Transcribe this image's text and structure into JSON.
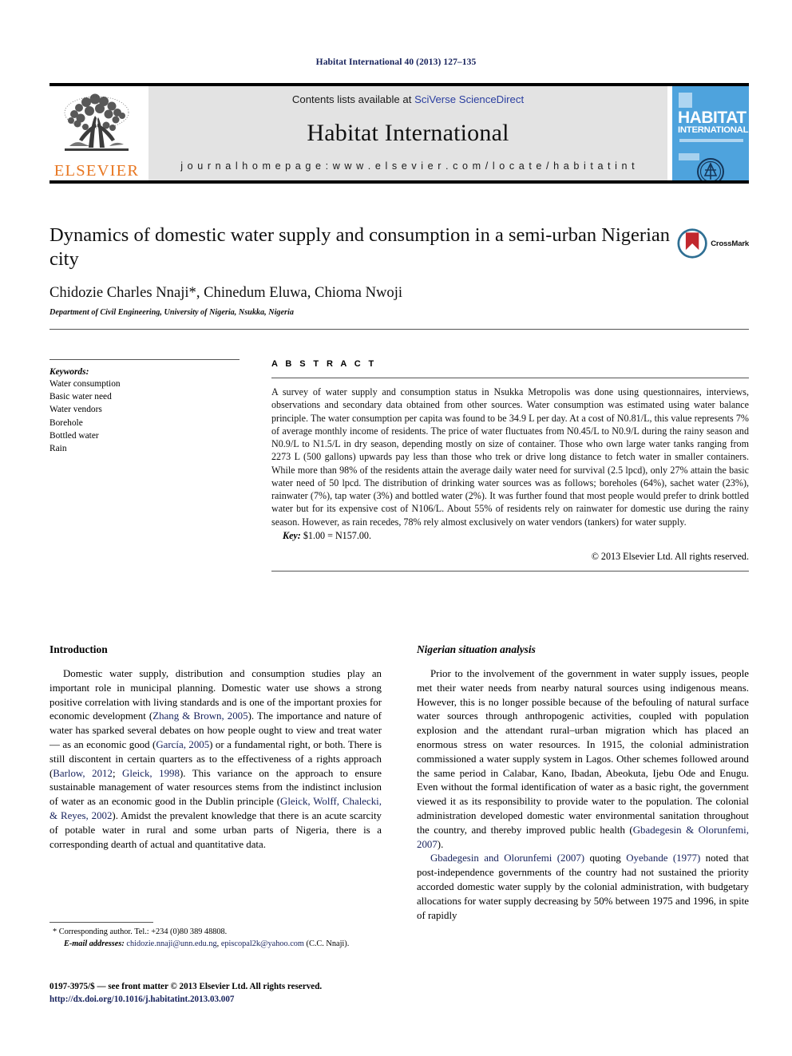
{
  "running_head": "Habitat International 40 (2013) 127–135",
  "masthead": {
    "publisher_logo_name": "ELSEVIER",
    "contents_prefix": "Contents lists available at ",
    "contents_link": "SciVerse ScienceDirect",
    "journal_name": "Habitat International",
    "homepage_label": "j o u r n a l   h o m e p a g e :   w w w . e l s e v i e r . c o m / l o c a t e / h a b i t a t i n t",
    "cover": {
      "line1": "HABITAT",
      "line2": "INTERNATIONAL"
    }
  },
  "article": {
    "title": "Dynamics of domestic water supply and consumption in a semi-urban Nigerian city",
    "crossmark_label": "CrossMark",
    "authors": "Chidozie Charles Nnaji*, Chinedum Eluwa, Chioma Nwoji",
    "affiliation": "Department of Civil Engineering, University of Nigeria, Nsukka, Nigeria"
  },
  "keywords": {
    "heading": "Keywords:",
    "items": [
      "Water consumption",
      "Basic water need",
      "Water vendors",
      "Borehole",
      "Bottled water",
      "Rain"
    ]
  },
  "abstract": {
    "heading": "A B S T R A C T",
    "text": "A survey of water supply and consumption status in Nsukka Metropolis was done using questionnaires, interviews, observations and secondary data obtained from other sources. Water consumption was estimated using water balance principle. The water consumption per capita was found to be 34.9 L per day. At a cost of N0.81/L, this value represents 7% of average monthly income of residents. The price of water fluctuates from N0.45/L to N0.9/L during the rainy season and N0.9/L to N1.5/L in dry season, depending mostly on size of container. Those who own large water tanks ranging from 2273 L (500 gallons) upwards pay less than those who trek or drive long distance to fetch water in smaller containers. While more than 98% of the residents attain the average daily water need for survival (2.5 lpcd), only 27% attain the basic water need of 50 lpcd. The distribution of drinking water sources was as follows; boreholes (64%), sachet water (23%), rainwater (7%), tap water (3%) and bottled water (2%). It was further found that most people would prefer to drink bottled water but for its expensive cost of N106/L. About 55% of residents rely on rainwater for domestic use during the rainy season. However, as rain recedes, 78% rely almost exclusively on water vendors (tankers) for water supply.",
    "key_label": "Key:",
    "key_value": "$1.00 = N157.00.",
    "copyright": "© 2013 Elsevier Ltd. All rights reserved."
  },
  "body": {
    "left": {
      "heading": "Introduction",
      "paragraph_1_a": "Domestic water supply, distribution and consumption studies play an important role in municipal planning. Domestic water use shows a strong positive correlation with living standards and is one of the important proxies for economic development (",
      "ref_1": "Zhang & Brown, 2005",
      "paragraph_1_b": "). The importance and nature of water has sparked several debates on how people ought to view and treat water — as an economic good (",
      "ref_2": "García, 2005",
      "paragraph_1_c": ") or a fundamental right, or both. There is still discontent in certain quarters as to the effectiveness of a rights approach (",
      "ref_3": "Barlow, 2012",
      "paragraph_1_d": "; ",
      "ref_4": "Gleick, 1998",
      "paragraph_1_e": "). This variance on the approach to ensure sustainable management of water resources stems from the indistinct inclusion of water as an economic good in the Dublin principle (",
      "ref_5": "Gleick, Wolff, Chalecki, & Reyes, 2002",
      "paragraph_1_f": "). Amidst the prevalent knowledge that there is an acute scarcity of potable water in rural and some urban parts of Nigeria, there is a corresponding dearth of actual and quantitative data."
    },
    "right": {
      "heading": "Nigerian situation analysis",
      "paragraph_1_a": "Prior to the involvement of the government in water supply issues, people met their water needs from nearby natural sources using indigenous means. However, this is no longer possible because of the befouling of natural surface water sources through anthropogenic activities, coupled with population explosion and the attendant rural–urban migration which has placed an enormous stress on water resources. In 1915, the colonial administration commissioned a water supply system in Lagos. Other schemes followed around the same period in Calabar, Kano, Ibadan, Abeokuta, Ijebu Ode and Enugu. Even without the formal identification of water as a basic right, the government viewed it as its responsibility to provide water to the population. The colonial administration developed domestic water environmental sanitation throughout the country, and thereby improved public health (",
      "ref_1": "Gbadegesin & Olorunfemi, 2007",
      "paragraph_1_b": ").",
      "ref_2": "Gbadegesin and Olorunfemi (2007)",
      "paragraph_2_a": " quoting ",
      "ref_3": "Oyebande (1977)",
      "paragraph_2_b": " noted that post-independence governments of the country had not sustained the priority accorded domestic water supply by the colonial administration, with budgetary allocations for water supply decreasing by 50% between 1975 and 1996, in spite of rapidly"
    }
  },
  "footnotes": {
    "corresponding": "* Corresponding author. Tel.: +234 (0)80 389 48808.",
    "email_label": "E-mail addresses:",
    "email_1": "chidozie.nnaji@unn.edu.ng",
    "email_sep": ", ",
    "email_2": "episcopal2k@yahoo.com",
    "email_suffix": " (C.C. Nnaji)."
  },
  "footer": {
    "issn_line": "0197-3975/$ — see front matter © 2013 Elsevier Ltd. All rights reserved.",
    "doi": "http://dx.doi.org/10.1016/j.habitatint.2013.03.007"
  },
  "colors": {
    "link": "#16215b",
    "elsevier_orange": "#e87722",
    "cover_blue": "#4ea3dd",
    "masthead_grey": "#e3e3e3"
  }
}
